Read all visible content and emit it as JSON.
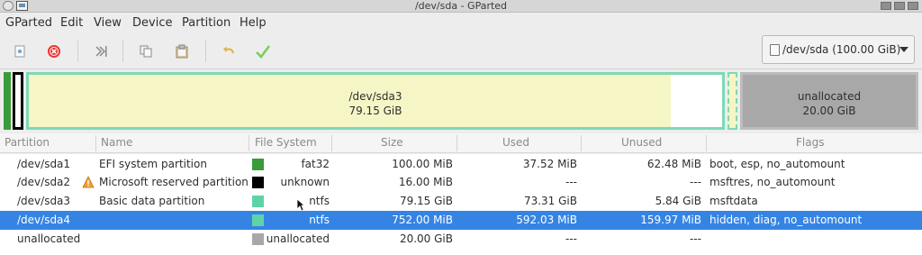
{
  "window": {
    "title": "/dev/sda - GParted"
  },
  "menu": [
    "GParted",
    "Edit",
    "View",
    "Device",
    "Partition",
    "Help"
  ],
  "toolbar": {
    "icons": [
      "new-icon",
      "delete-icon",
      "resize-move-icon",
      "copy-icon",
      "paste-icon",
      "undo-icon",
      "apply-icon"
    ],
    "device_label": "/dev/sda (100.00 GiB)"
  },
  "diskmap": {
    "main_partition": {
      "name": "/dev/sda3",
      "size": "79.15 GiB",
      "used_fraction": 0.926
    },
    "unallocated": {
      "name": "unallocated",
      "size": "20.00 GiB"
    }
  },
  "columns": [
    "Partition",
    "Name",
    "File System",
    "Size",
    "Used",
    "Unused",
    "Flags"
  ],
  "rows": [
    {
      "partition": "/dev/sda1",
      "name": "EFI system partition",
      "fs": "fat32",
      "fs_color": "#3a9b3a",
      "size": "100.00 MiB",
      "used": "37.52 MiB",
      "unused": "62.48 MiB",
      "flags": "boot, esp, no_automount",
      "warning": false,
      "selected": false
    },
    {
      "partition": "/dev/sda2",
      "name": "Microsoft reserved partition",
      "fs": "unknown",
      "fs_color": "#000000",
      "size": "16.00 MiB",
      "used": "---",
      "unused": "---",
      "flags": "msftres, no_automount",
      "warning": true,
      "selected": false
    },
    {
      "partition": "/dev/sda3",
      "name": "Basic data partition",
      "fs": "ntfs",
      "fs_color": "#5fd3a8",
      "size": "79.15 GiB",
      "used": "73.31 GiB",
      "unused": "5.84 GiB",
      "flags": "msftdata",
      "warning": false,
      "selected": false
    },
    {
      "partition": "/dev/sda4",
      "name": "",
      "fs": "ntfs",
      "fs_color": "#5fd3a8",
      "size": "752.00 MiB",
      "used": "592.03 MiB",
      "unused": "159.97 MiB",
      "flags": "hidden, diag, no_automount",
      "warning": false,
      "selected": true
    },
    {
      "partition": "unallocated",
      "name": "",
      "fs": "unallocated",
      "fs_color": "#a8a8a8",
      "size": "20.00 GiB",
      "used": "---",
      "unused": "---",
      "flags": "",
      "warning": false,
      "selected": false
    }
  ]
}
